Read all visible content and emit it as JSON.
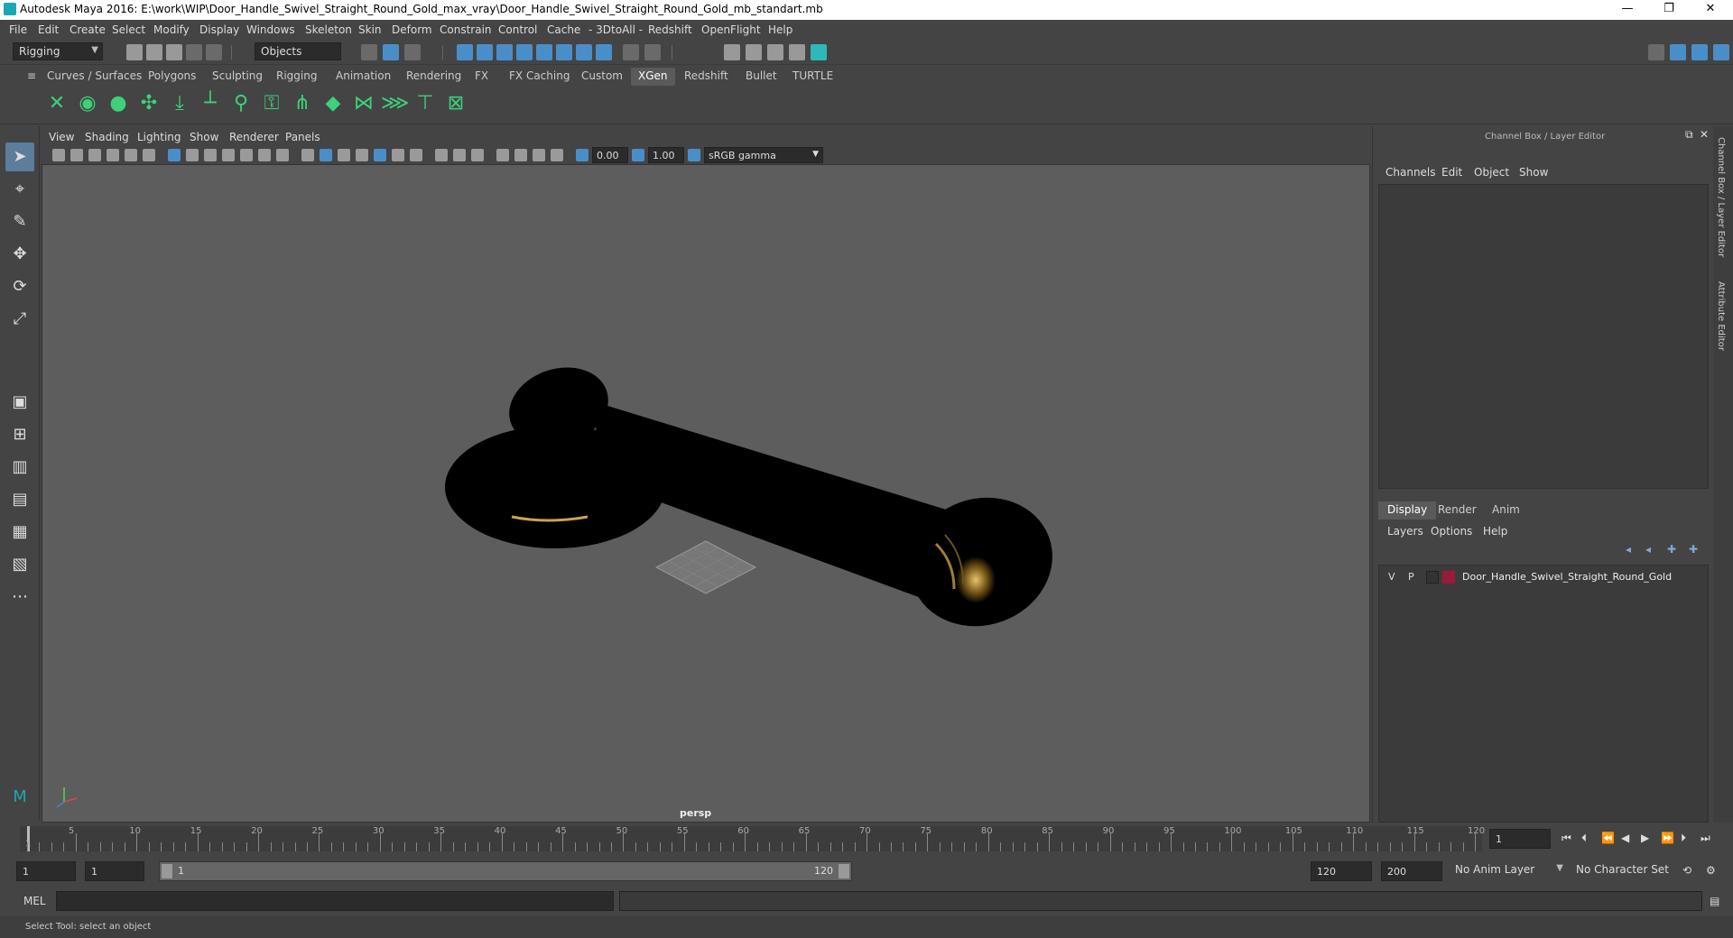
{
  "window": {
    "title": "Autodesk Maya 2016: E:\\work\\WIP\\Door_Handle_Swivel_Straight_Round_Gold_max_vray\\Door_Handle_Swivel_Straight_Round_Gold_mb_standart.mb",
    "minimize": "—",
    "restore": "❐",
    "close": "✕"
  },
  "menubar": [
    "File",
    "Edit",
    "Create",
    "Select",
    "Modify",
    "Display",
    "Windows",
    "Skeleton",
    "Skin",
    "Deform",
    "Constrain",
    "Control",
    "Cache",
    "- 3DtoAll -",
    "Redshift",
    "OpenFlight",
    "Help"
  ],
  "statusline": {
    "menuset": "Rigging",
    "selection_mode": "Objects"
  },
  "shelf_tabs": [
    "Curves / Surfaces",
    "Polygons",
    "Sculpting",
    "Rigging",
    "Animation",
    "Rendering",
    "FX",
    "FX Caching",
    "Custom",
    "XGen",
    "Redshift",
    "Bullet",
    "TURTLE"
  ],
  "shelf_active": "XGen",
  "viewport": {
    "menus": [
      "View",
      "Shading",
      "Lighting",
      "Show",
      "Renderer",
      "Panels"
    ],
    "exposure": "0.00",
    "gamma": "1.00",
    "color_space": "sRGB gamma",
    "camera_label": "persp"
  },
  "channel_box": {
    "header": "Channel Box / Layer Editor",
    "menus": [
      "Channels",
      "Edit",
      "Object",
      "Show"
    ]
  },
  "layer_editor": {
    "tabs": [
      "Display",
      "Render",
      "Anim"
    ],
    "active_tab": "Display",
    "menus": [
      "Layers",
      "Options",
      "Help"
    ],
    "layers": [
      {
        "visible": "V",
        "playback": "P",
        "name": "Door_Handle_Swivel_Straight_Round_Gold",
        "color": "#9b1a3a"
      }
    ]
  },
  "side_tabs": [
    "Channel Box / Layer Editor",
    "Attribute Editor"
  ],
  "timeline": {
    "start_label": "1",
    "labels": [
      "5",
      "10",
      "15",
      "20",
      "25",
      "30",
      "35",
      "40",
      "45",
      "50",
      "55",
      "60",
      "65",
      "70",
      "75",
      "80",
      "85",
      "90",
      "95",
      "100",
      "105",
      "110",
      "115",
      "120"
    ],
    "current_frame": "1",
    "current_frame_value": 1,
    "range_min": 1,
    "range_max": 120
  },
  "range": {
    "anim_start": "1",
    "playback_start": "1",
    "slider_start": "1",
    "slider_end": "120",
    "playback_end": "120",
    "anim_end": "200",
    "anim_layer": "No Anim Layer",
    "character_set": "No Character Set"
  },
  "command": {
    "language": "MEL"
  },
  "help_line": "Select Tool: select an object",
  "colors": {
    "accent_blue": "#4a8ec9",
    "shelf_green": "#3fd07a",
    "layer_color": "#9b1a3a"
  }
}
